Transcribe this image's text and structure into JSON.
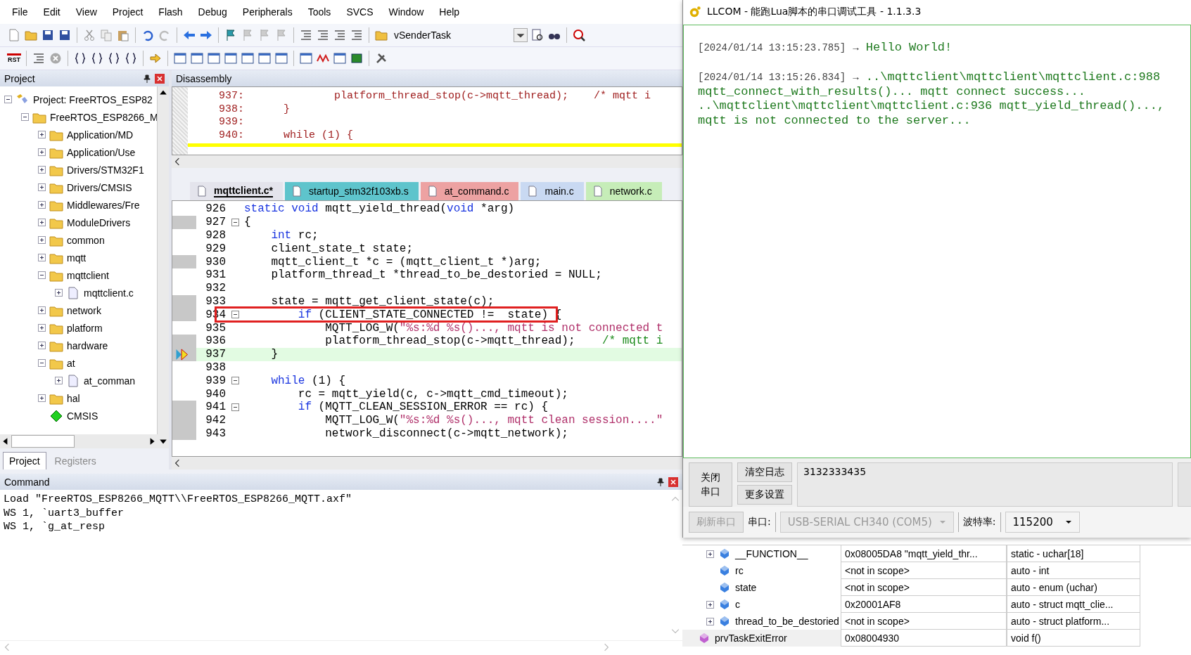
{
  "menu": [
    "File",
    "Edit",
    "View",
    "Project",
    "Flash",
    "Debug",
    "Peripherals",
    "Tools",
    "SVCS",
    "Window",
    "Help"
  ],
  "toolbar": {
    "target_combo": "vSenderTask",
    "reset_label": "RST"
  },
  "project_panel": {
    "title": "Project",
    "tree": [
      {
        "label": "Project: FreeRTOS_ESP82",
        "kind": "project",
        "expanded": true,
        "children": [
          {
            "label": "FreeRTOS_ESP8266_M",
            "kind": "target",
            "expanded": true,
            "children": [
              {
                "label": "Application/MD",
                "kind": "folder",
                "expanded": false
              },
              {
                "label": "Application/Use",
                "kind": "folder",
                "expanded": false
              },
              {
                "label": "Drivers/STM32F1",
                "kind": "folder",
                "expanded": false
              },
              {
                "label": "Drivers/CMSIS",
                "kind": "folder",
                "expanded": false
              },
              {
                "label": "Middlewares/Fre",
                "kind": "folder",
                "expanded": false
              },
              {
                "label": "ModuleDrivers",
                "kind": "folder",
                "expanded": false
              },
              {
                "label": "common",
                "kind": "folder",
                "expanded": false
              },
              {
                "label": "mqtt",
                "kind": "folder",
                "expanded": false
              },
              {
                "label": "mqttclient",
                "kind": "folder",
                "expanded": true,
                "children": [
                  {
                    "label": "mqttclient.c",
                    "kind": "file",
                    "expanded": false
                  }
                ]
              },
              {
                "label": "network",
                "kind": "folder",
                "expanded": false
              },
              {
                "label": "platform",
                "kind": "folder",
                "expanded": false
              },
              {
                "label": "hardware",
                "kind": "folder",
                "expanded": false
              },
              {
                "label": "at",
                "kind": "folder",
                "expanded": true,
                "children": [
                  {
                    "label": "at_comman",
                    "kind": "file",
                    "expanded": false
                  }
                ]
              },
              {
                "label": "hal",
                "kind": "folder",
                "expanded": false
              },
              {
                "label": "CMSIS",
                "kind": "component"
              }
            ]
          }
        ]
      }
    ],
    "tabs": [
      {
        "label": "Project",
        "selected": true
      },
      {
        "label": "Registers",
        "selected": false
      }
    ]
  },
  "disassembly": {
    "title": "Disassembly",
    "lines": [
      {
        "number": "937:",
        "code": "            platform_thread_stop(c->mqtt_thread);    /* mqtt i"
      },
      {
        "number": "938:",
        "code": "    }"
      },
      {
        "number": "939:"
      },
      {
        "number": "940:",
        "code": "    while (1) {"
      }
    ]
  },
  "editor": {
    "tabs": [
      {
        "label": "mqttclient.c*",
        "selected": true,
        "color": "#e4e4ec"
      },
      {
        "label": "startup_stm32f103xb.s",
        "selected": false,
        "color": "#5ec4cc"
      },
      {
        "label": "at_command.c",
        "selected": false,
        "color": "#eda2a2"
      },
      {
        "label": "main.c",
        "selected": false,
        "color": "#c9d9f2"
      },
      {
        "label": "network.c",
        "selected": false,
        "color": "#c6edb8"
      }
    ],
    "lines": [
      {
        "number": "926",
        "executable": false,
        "current": false,
        "highlighted": false,
        "tokens": [
          {
            "kind": "keyword",
            "text": "static void"
          },
          {
            "kind": "plain",
            "text": " mqtt_yield_thread("
          },
          {
            "kind": "keyword",
            "text": "void"
          },
          {
            "kind": "plain",
            "text": " *arg)"
          }
        ]
      },
      {
        "number": "927",
        "executable": true,
        "current": false,
        "highlighted": false,
        "folded": false,
        "tokens": [
          {
            "kind": "plain",
            "text": "{"
          }
        ]
      },
      {
        "number": "928",
        "executable": false,
        "current": false,
        "highlighted": false,
        "tokens": [
          {
            "kind": "keyword",
            "text": "    int"
          },
          {
            "kind": "plain",
            "text": " rc;"
          }
        ]
      },
      {
        "number": "929",
        "executable": false,
        "current": false,
        "highlighted": false,
        "tokens": [
          {
            "kind": "plain",
            "text": "    client_state_t state;"
          }
        ]
      },
      {
        "number": "930",
        "executable": true,
        "current": false,
        "highlighted": false,
        "tokens": [
          {
            "kind": "plain",
            "text": "    mqtt_client_t *c = (mqtt_client_t *)arg;"
          }
        ]
      },
      {
        "number": "931",
        "executable": false,
        "current": false,
        "highlighted": false,
        "tokens": [
          {
            "kind": "plain",
            "text": "    platform_thread_t *thread_to_be_destoried = NULL;"
          }
        ]
      },
      {
        "number": "932",
        "executable": false,
        "current": false,
        "highlighted": false
      },
      {
        "number": "933",
        "executable": true,
        "current": false,
        "highlighted": false,
        "tokens": [
          {
            "kind": "plain",
            "text": "    state = mqtt_get_client_state(c);"
          }
        ]
      },
      {
        "number": "934",
        "executable": true,
        "current": false,
        "highlighted": true,
        "folded": false,
        "tokens": [
          {
            "kind": "keyword",
            "text": "        if"
          },
          {
            "kind": "plain",
            "text": " (CLIENT_STATE_CONNECTED !=  state) {"
          }
        ]
      },
      {
        "number": "935",
        "executable": false,
        "current": false,
        "highlighted": false,
        "tokens": [
          {
            "kind": "plain",
            "text": "            MQTT_LOG_W("
          },
          {
            "kind": "string",
            "text": "\"%s:%d %s()..., mqtt is not connected t"
          }
        ]
      },
      {
        "number": "936",
        "executable": true,
        "current": false,
        "highlighted": false,
        "tokens": [
          {
            "kind": "plain",
            "text": "            platform_thread_stop(c->mqtt_thread);    "
          },
          {
            "kind": "comment",
            "text": "/* mqtt i"
          }
        ]
      },
      {
        "number": "937",
        "executable": true,
        "current": true,
        "highlighted": false,
        "tokens": [
          {
            "kind": "plain",
            "text": "    }"
          }
        ]
      },
      {
        "number": "938",
        "executable": false,
        "current": false,
        "highlighted": false
      },
      {
        "number": "939",
        "executable": false,
        "current": false,
        "highlighted": false,
        "folded": false,
        "tokens": [
          {
            "kind": "keyword",
            "text": "    while"
          },
          {
            "kind": "plain",
            "text": " (1) {"
          }
        ]
      },
      {
        "number": "940",
        "executable": false,
        "current": false,
        "highlighted": false,
        "tokens": [
          {
            "kind": "plain",
            "text": "        rc = mqtt_yield(c, c->mqtt_cmd_timeout);"
          }
        ]
      },
      {
        "number": "941",
        "executable": true,
        "current": false,
        "highlighted": false,
        "folded": false,
        "tokens": [
          {
            "kind": "keyword",
            "text": "        if"
          },
          {
            "kind": "plain",
            "text": " (MQTT_CLEAN_SESSION_ERROR == rc) {"
          }
        ]
      },
      {
        "number": "942",
        "executable": true,
        "current": false,
        "highlighted": false,
        "tokens": [
          {
            "kind": "plain",
            "text": "            MQTT_LOG_W("
          },
          {
            "kind": "string",
            "text": "\"%s:%d %s()..., mqtt clean session....\""
          }
        ]
      },
      {
        "number": "943",
        "executable": true,
        "current": false,
        "highlighted": false,
        "tokens": [
          {
            "kind": "plain",
            "text": "            network_disconnect(c->mqtt_network);"
          }
        ]
      }
    ]
  },
  "command": {
    "title": "Command",
    "lines": [
      "Load \"FreeRTOS_ESP8266_MQTT\\\\FreeRTOS_ESP8266_MQTT.axf\"",
      "WS 1, `uart3_buffer",
      "WS 1, `g_at_resp"
    ]
  },
  "llcom": {
    "title": "LLCOM - 能跑Lua脚本的串口调试工具 - 1.1.3.3",
    "log": [
      {
        "timestamp": "[2024/01/14 13:15:23.785]",
        "arrow": "→",
        "message": "Hello World!"
      },
      {
        "timestamp": "[2024/01/14 13:15:26.834]",
        "arrow": "→",
        "message": "..\\mqttclient\\mqttclient\\mqttclient.c:988 mqtt_connect_with_results()... mqtt connect success... ..\\mqttclient\\mqttclient\\mqttclient.c:936 mqtt_yield_thread()..., mqtt is not connected to the server..."
      }
    ],
    "close_port": "关闭串口",
    "clear_log": "清空日志",
    "more_settings": "更多设置",
    "send_value": "3132333435",
    "refresh_port": {
      "label": "刷新串口",
      "disabled": true
    },
    "port_label": "串口:",
    "port": {
      "value": "USB-SERIAL CH340 (COM5)",
      "disabled": true
    },
    "baud_label": "波特率:",
    "baud": {
      "value": "115200",
      "disabled": false
    }
  },
  "watch": {
    "rows": [
      {
        "name": "__FUNCTION__",
        "value": "0x08005DA8 \"mqtt_yield_thr...",
        "type": "static - uchar[18]",
        "kind": "local",
        "expanded": false
      },
      {
        "name": "rc",
        "value": "<not in scope>",
        "type": "auto - int",
        "kind": "local"
      },
      {
        "name": "state",
        "value": "<not in scope>",
        "type": "auto - enum (uchar)",
        "kind": "local"
      },
      {
        "name": "c",
        "value": "0x20001AF8",
        "type": "auto - struct mqtt_clie...",
        "kind": "local",
        "expanded": false
      },
      {
        "name": "thread_to_be_destoried",
        "value": "<not in scope>",
        "type": "auto - struct platform...",
        "kind": "local",
        "expanded": false
      },
      {
        "name": "prvTaskExitError",
        "value": "0x08004930",
        "type": "void f()",
        "kind": "function"
      }
    ]
  }
}
